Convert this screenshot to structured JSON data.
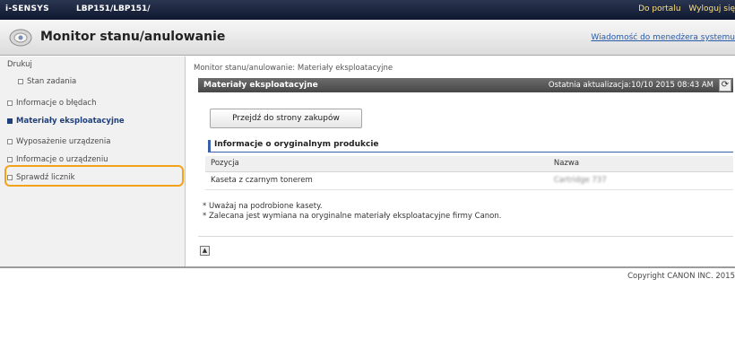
{
  "topbar": {
    "brand": "i-SENSYS",
    "model": "LBP151/LBP151/",
    "portal_link": "Do portalu",
    "logout_link": "Wyloguj się"
  },
  "titlebar": {
    "title": "Monitor stanu/anulowanie",
    "message_link": "Wiadomość do menedżera systemu"
  },
  "sidebar": {
    "section": "Drukuj",
    "items": [
      {
        "label": "Stan zadania"
      },
      {
        "label": "Informacje o błędach"
      },
      {
        "label": "Materiały eksploatacyjne"
      },
      {
        "label": "Wyposażenie urządzenia"
      },
      {
        "label": "Informacje o urządzeniu"
      },
      {
        "label": "Sprawdź licznik"
      }
    ]
  },
  "main": {
    "breadcrumb": "Monitor stanu/anulowanie: Materiały eksploatacyjne",
    "section_title": "Materiały eksploatacyjne",
    "last_updated": "Ostatnia aktualizacja:10/10 2015 08:43 AM",
    "purchase_button": "Przejdź do strony zakupów",
    "subheading": "Informacje o oryginalnym produkcie",
    "table": {
      "headers": [
        "Pozycja",
        "Nazwa"
      ],
      "rows": [
        [
          "Kaseta z czarnym tonerem",
          "Cartridge 737"
        ]
      ]
    },
    "notes": [
      "* Uważaj na podrobione kasety.",
      "* Zalecana jest wymiana na oryginalne materiały eksploatacyjne firmy Canon."
    ]
  },
  "footer": {
    "copyright": "Copyright CANON INC. 2015"
  },
  "colors": {
    "topbar": "#1c2540",
    "highlight": "#f5a21b",
    "link": "#2a5ba8"
  }
}
